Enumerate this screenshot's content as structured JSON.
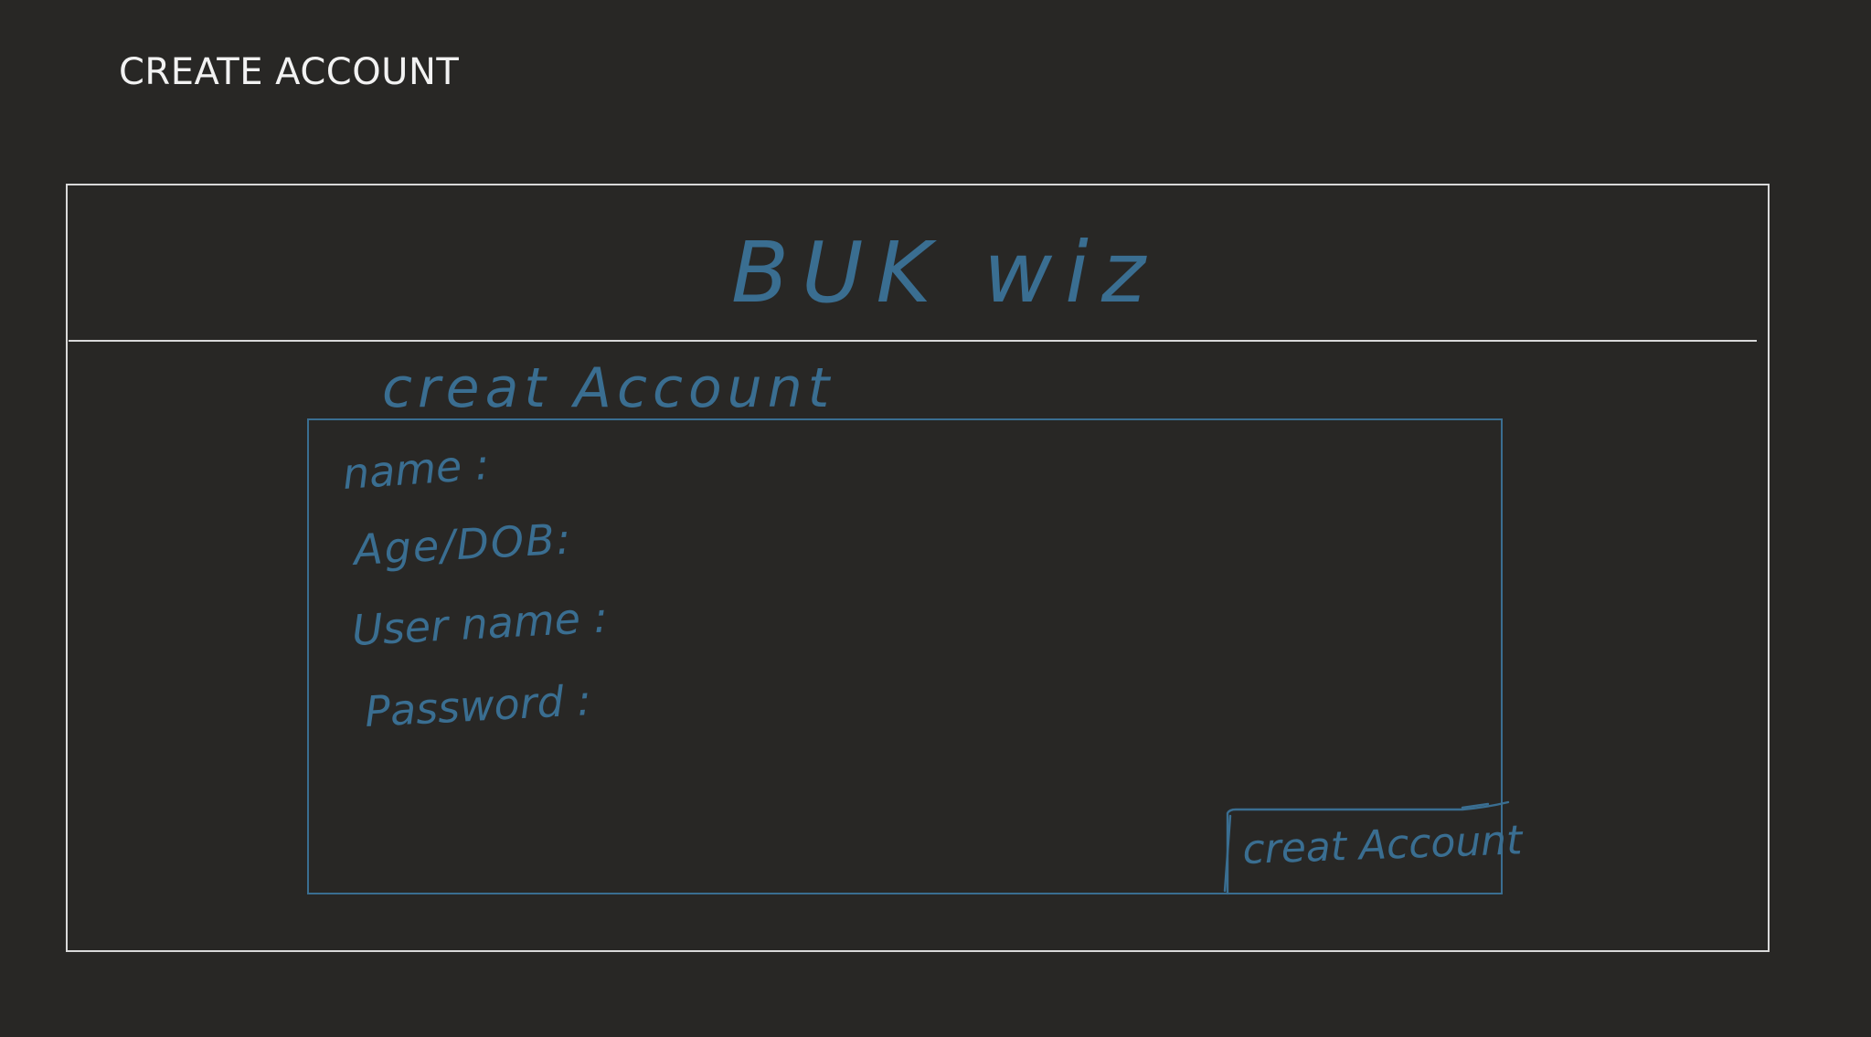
{
  "slide": {
    "title": "CREATE ACCOUNT"
  },
  "app": {
    "name": "BUK wiz"
  },
  "form": {
    "heading": "creat Account",
    "fields": [
      {
        "label": "name :"
      },
      {
        "label": "Age/DOB:"
      },
      {
        "label": "User name :"
      },
      {
        "label": "Password :"
      }
    ],
    "submit_label": "creat Account"
  },
  "colors": {
    "background": "#282725",
    "frame": "#d9d9d9",
    "ink": "#3a6e91",
    "title_text": "#f2f2f2"
  }
}
